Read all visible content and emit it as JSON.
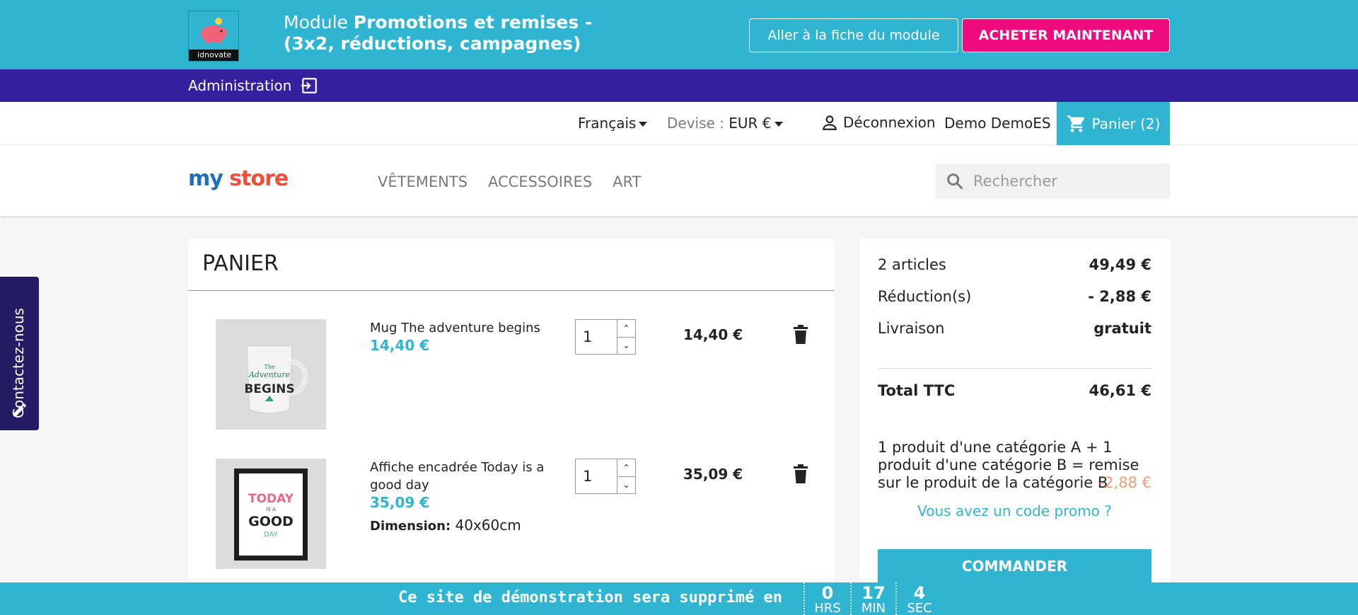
{
  "promo_bar": {
    "logo_text": "idnovate",
    "title_prefix": "Module ",
    "title_bold": "Promotions et remises - (3x2, réductions, campagnes)",
    "module_button": "Aller à la fiche du module",
    "buy_button": "ACHETER MAINTENANT",
    "colors": {
      "bar": "#2fb5d2",
      "buy": "#ef0a7d"
    }
  },
  "admin_bar": {
    "label": "Administration",
    "icon": "sign-in-icon"
  },
  "user_nav": {
    "language": "Français",
    "currency_label": "Devise :",
    "currency_value": "EUR €",
    "logout": "Déconnexion",
    "username": "Demo DemoES",
    "cart": "Panier (2)"
  },
  "header": {
    "logo_part1": "my",
    "logo_part2": " store",
    "menu": [
      "VÊTEMENTS",
      "ACCESSOIRES",
      "ART"
    ],
    "search_placeholder": "Rechercher"
  },
  "cart": {
    "title": "PANIER",
    "items": [
      {
        "name": "Mug The adventure begins",
        "price": "14,40 €",
        "quantity": "1",
        "total": "14,40 €",
        "image_icon": "mug-image"
      },
      {
        "name": "Affiche encadrée Today is a good day",
        "price": "35,09 €",
        "attribute_label": "Dimension:",
        "attribute_value": " 40x60cm",
        "quantity": "1",
        "total": "35,09 €",
        "image_icon": "framed-poster-image",
        "poster_text": [
          "TODAY",
          "IS A",
          "GOOD",
          "DAY"
        ]
      }
    ]
  },
  "summary": {
    "articles_label": "2 articles",
    "articles_value": "49,49 €",
    "discount_label": "Réduction(s)",
    "discount_value": "- 2,88 €",
    "shipping_label": "Livraison",
    "shipping_value": "gratuit",
    "total_label": "Total TTC",
    "total_value": "46,61 €",
    "rule_text": "1 produit d'une catégorie A + 1 produit d'une catégorie B = remise sur le produit de la catégorie B",
    "rule_amount": "-2,88 €",
    "promo_link": "Vous avez un code promo ?",
    "order_button": "COMMANDER"
  },
  "contact_tab": {
    "label": "Contactez-nous",
    "icon": "pencil-icon"
  },
  "countdown": {
    "text": "Ce site de démonstration sera supprimé en",
    "hours": "0",
    "hours_unit": "HRS",
    "minutes": "17",
    "minutes_unit": "MIN",
    "seconds": "4",
    "seconds_unit": "SEC"
  }
}
